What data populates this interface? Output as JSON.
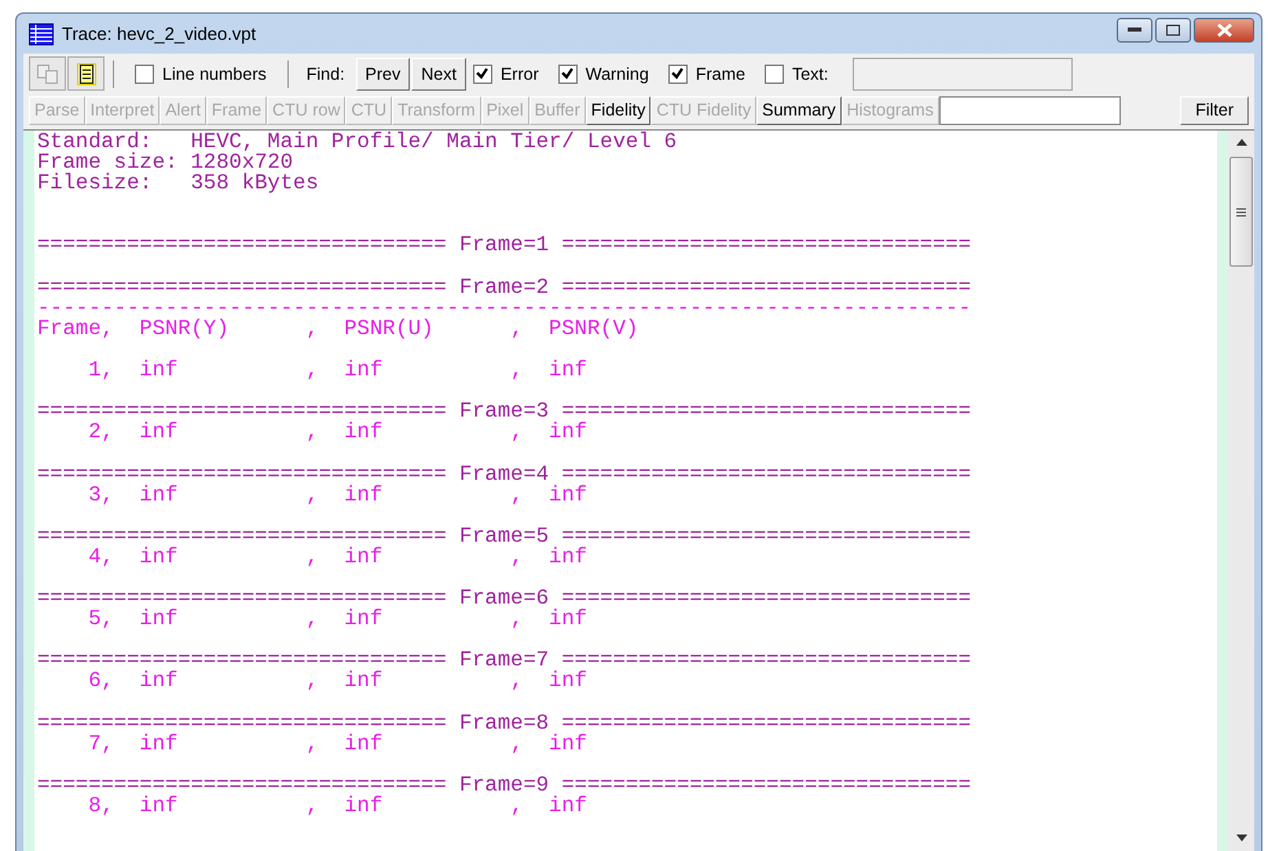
{
  "window": {
    "title": "Trace: hevc_2_video.vpt"
  },
  "toolbar": {
    "line_numbers": {
      "label": "Line numbers",
      "checked": false
    },
    "find_label": "Find:",
    "find_buttons": [
      "Prev",
      "Next"
    ],
    "filters": [
      {
        "label": "Error",
        "checked": true
      },
      {
        "label": "Warning",
        "checked": true
      },
      {
        "label": "Frame",
        "checked": true
      },
      {
        "label": "Text:",
        "checked": false
      }
    ]
  },
  "views": [
    {
      "label": "Parse",
      "disabled": true
    },
    {
      "label": "Interpret",
      "disabled": true
    },
    {
      "label": "Alert",
      "disabled": true
    },
    {
      "label": "Frame",
      "disabled": true
    },
    {
      "label": "CTU row",
      "disabled": true
    },
    {
      "label": "CTU",
      "disabled": true
    },
    {
      "label": "Transform",
      "disabled": true
    },
    {
      "label": "Pixel",
      "disabled": true
    },
    {
      "label": "Buffer",
      "disabled": true
    },
    {
      "label": "Fidelity",
      "disabled": false
    },
    {
      "label": "CTU Fidelity",
      "disabled": true
    },
    {
      "label": "Summary",
      "disabled": false
    },
    {
      "label": "Histograms",
      "disabled": true
    }
  ],
  "filter_button": "Filter",
  "trace_lines": [
    {
      "kind": "info",
      "text": "Standard:   HEVC, Main Profile/ Main Tier/ Level 6"
    },
    {
      "kind": "info",
      "text": "Frame size: 1280x720"
    },
    {
      "kind": "info",
      "text": "Filesize:   358 kBytes"
    },
    {
      "kind": "blank"
    },
    {
      "kind": "blank"
    },
    {
      "kind": "separator",
      "text": "================================ Frame=1 ================================"
    },
    {
      "kind": "blank"
    },
    {
      "kind": "separator",
      "text": "================================ Frame=2 ================================"
    },
    {
      "kind": "data",
      "text": "-------------------------------------------------------------------------"
    },
    {
      "kind": "data",
      "text": "Frame,  PSNR(Y)      ,  PSNR(U)      ,  PSNR(V)"
    },
    {
      "kind": "blank"
    },
    {
      "kind": "data",
      "text": "    1,  inf          ,  inf          ,  inf"
    },
    {
      "kind": "blank"
    },
    {
      "kind": "separator",
      "text": "================================ Frame=3 ================================"
    },
    {
      "kind": "data",
      "text": "    2,  inf          ,  inf          ,  inf"
    },
    {
      "kind": "blank"
    },
    {
      "kind": "separator",
      "text": "================================ Frame=4 ================================"
    },
    {
      "kind": "data",
      "text": "    3,  inf          ,  inf          ,  inf"
    },
    {
      "kind": "blank"
    },
    {
      "kind": "separator",
      "text": "================================ Frame=5 ================================"
    },
    {
      "kind": "data",
      "text": "    4,  inf          ,  inf          ,  inf"
    },
    {
      "kind": "blank"
    },
    {
      "kind": "separator",
      "text": "================================ Frame=6 ================================"
    },
    {
      "kind": "data",
      "text": "    5,  inf          ,  inf          ,  inf"
    },
    {
      "kind": "blank"
    },
    {
      "kind": "separator",
      "text": "================================ Frame=7 ================================"
    },
    {
      "kind": "data",
      "text": "    6,  inf          ,  inf          ,  inf"
    },
    {
      "kind": "blank"
    },
    {
      "kind": "separator",
      "text": "================================ Frame=8 ================================"
    },
    {
      "kind": "data",
      "text": "    7,  inf          ,  inf          ,  inf"
    },
    {
      "kind": "blank"
    },
    {
      "kind": "separator",
      "text": "================================ Frame=9 ================================"
    },
    {
      "kind": "data",
      "text": "    8,  inf          ,  inf          ,  inf"
    }
  ]
}
